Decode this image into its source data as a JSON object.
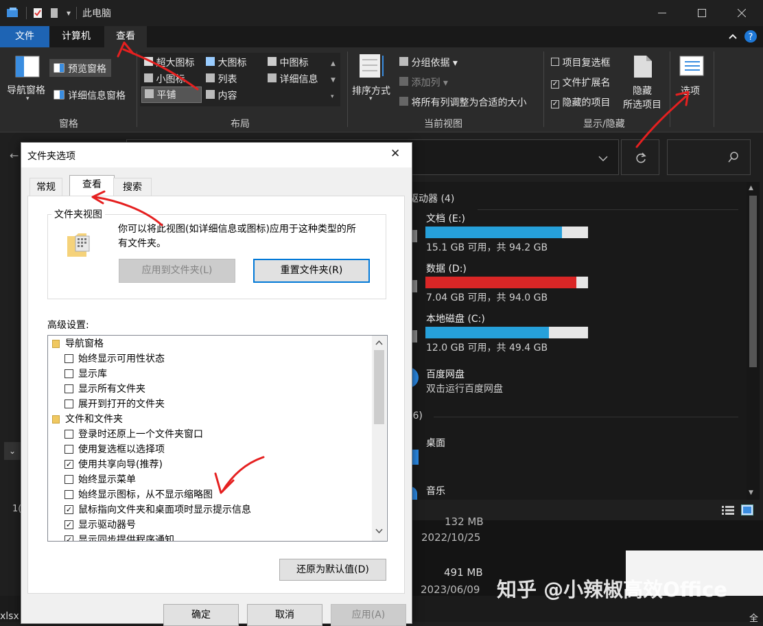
{
  "window": {
    "title": "此电脑",
    "qa_dropdown": "▾"
  },
  "ribbon_tabs": [
    "文件",
    "计算机",
    "查看"
  ],
  "ribbon": {
    "panes": {
      "nav_pane": "导航窗格",
      "preview_pane": "预览窗格",
      "details_pane": "详细信息窗格",
      "group": "窗格"
    },
    "layout": {
      "items": [
        "超大图标",
        "大图标",
        "中图标",
        "小图标",
        "列表",
        "详细信息",
        "平铺",
        "内容"
      ],
      "group": "布局"
    },
    "current_view": {
      "sort_by": "排序方式",
      "group_by": "分组依据",
      "add_column": "添加列",
      "fit_columns": "将所有列调整为合适的大小",
      "group": "当前视图"
    },
    "show_hide": {
      "item_checkboxes": {
        "label": "项目复选框",
        "checked": false
      },
      "file_extensions": {
        "label": "文件扩展名",
        "checked": true
      },
      "hidden_items": {
        "label": "隐藏的项目",
        "checked": true
      },
      "hide_selected_1": "隐藏",
      "hide_selected_2": "所选项目",
      "group": "显示/隐藏"
    },
    "options": "选项"
  },
  "drives_header": "驱动器 (4)",
  "drives": [
    {
      "name": "文档 (E:)",
      "info": "15.1 GB 可用，共 94.2 GB",
      "used_fraction": 0.84,
      "color": "#26a0da"
    },
    {
      "name": "数据 (D:)",
      "info": "7.04 GB 可用，共 94.0 GB",
      "used_fraction": 0.93,
      "color": "#da2626"
    },
    {
      "name": "本地磁盘 (C:)",
      "info": "12.0 GB 可用，共 49.4 GB",
      "used_fraction": 0.76,
      "color": "#26a0da"
    }
  ],
  "baidu": {
    "name": "百度网盘",
    "desc": "双击运行百度网盘"
  },
  "folders_header": "(6)",
  "folders": [
    "桌面",
    "音乐"
  ],
  "status_left": "1(",
  "background_files": [
    {
      "size": "132 MB",
      "date": "2022/10/25"
    },
    {
      "size": "491 MB",
      "date": "2023/06/09"
    }
  ],
  "taskbar_left": "xlsx",
  "watermark": "知乎 @小辣椒高效Office",
  "dialog": {
    "title": "文件夹选项",
    "close": "✕",
    "tabs": [
      "常规",
      "查看",
      "搜索"
    ],
    "folder_views": {
      "title": "文件夹视图",
      "desc_line1": "你可以将此视图(如详细信息或图标)应用于这种类型的所",
      "desc_line2": "有文件夹。",
      "apply_button": "应用到文件夹(L)",
      "reset_button": "重置文件夹(R)"
    },
    "advanced_label": "高级设置:",
    "advanced": [
      {
        "kind": "folder",
        "label": "导航窗格"
      },
      {
        "kind": "check",
        "label": "始终显示可用性状态",
        "checked": false
      },
      {
        "kind": "check",
        "label": "显示库",
        "checked": false
      },
      {
        "kind": "check",
        "label": "显示所有文件夹",
        "checked": false
      },
      {
        "kind": "check",
        "label": "展开到打开的文件夹",
        "checked": false
      },
      {
        "kind": "folder",
        "label": "文件和文件夹"
      },
      {
        "kind": "check",
        "label": "登录时还原上一个文件夹窗口",
        "checked": false
      },
      {
        "kind": "check",
        "label": "使用复选框以选择项",
        "checked": false
      },
      {
        "kind": "check",
        "label": "使用共享向导(推荐)",
        "checked": true
      },
      {
        "kind": "check",
        "label": "始终显示菜单",
        "checked": false
      },
      {
        "kind": "check",
        "label": "始终显示图标，从不显示缩略图",
        "checked": false
      },
      {
        "kind": "check",
        "label": "鼠标指向文件夹和桌面项时显示提示信息",
        "checked": true
      },
      {
        "kind": "check",
        "label": "显示驱动器号",
        "checked": true
      },
      {
        "kind": "check",
        "label": "显示同步提供程序通知",
        "checked": true
      }
    ],
    "restore_defaults": "还原为默认值(D)",
    "ok": "确定",
    "cancel": "取消",
    "apply": "应用(A)"
  }
}
